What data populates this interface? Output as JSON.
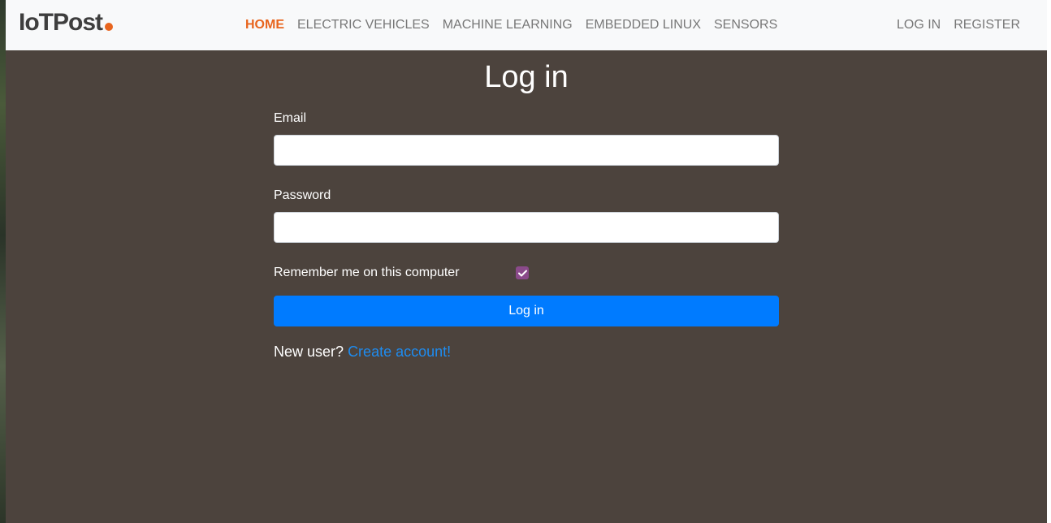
{
  "brand": {
    "name": "IoTPost",
    "accent_color": "#e8651e"
  },
  "nav": {
    "items": [
      {
        "label": "HOME",
        "active": true
      },
      {
        "label": "ELECTRIC VEHICLES",
        "active": false
      },
      {
        "label": "MACHINE LEARNING",
        "active": false
      },
      {
        "label": "EMBEDDED LINUX",
        "active": false
      },
      {
        "label": "SENSORS",
        "active": false
      }
    ],
    "auth": {
      "login": "LOG IN",
      "register": "REGISTER"
    }
  },
  "login_form": {
    "title": "Log in",
    "email_label": "Email",
    "email_value": "",
    "password_label": "Password",
    "password_value": "",
    "remember_label": "Remember me on this computer",
    "remember_checked": true,
    "submit_label": "Log in",
    "new_user_text": "New user?",
    "create_account_link": "Create account!"
  },
  "colors": {
    "page_background": "#4c433d",
    "primary_button": "#007bff",
    "link": "#1e8cf0",
    "checkbox": "#8a4a8a"
  }
}
